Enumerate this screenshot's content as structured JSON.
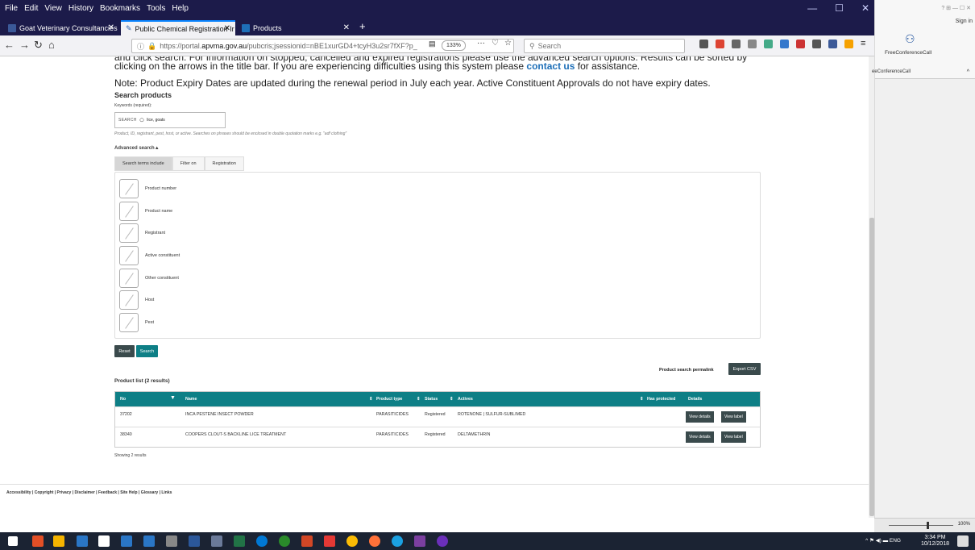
{
  "browser": {
    "menu": [
      "File",
      "Edit",
      "View",
      "History",
      "Bookmarks",
      "Tools",
      "Help"
    ],
    "tabs": [
      {
        "label": "Goat Veterinary Consultancies",
        "color": "#3b5998"
      },
      {
        "label": "Public Chemical Registration Ir",
        "color": "#2b5fa8"
      },
      {
        "label": "Products",
        "color": "#1e6fb8"
      }
    ],
    "url_prefix": "https://portal.",
    "url_domain": "apvma.gov.au",
    "url_rest": "/pubcris;jsessionid=nBE1xurGD4+tcyH3u2sr7fXF?p_",
    "zoom": "133%",
    "search_placeholder": "Search"
  },
  "page": {
    "intro_line1": "and click search. For information on stopped, cancelled and expired registrations please use the advanced search options. Results can be sorted by",
    "intro_line2_a": "clicking on the arrows in the title bar. If you are experiencing difficulties using this system please",
    "intro_link": "contact us",
    "intro_line2_b": "for assistance.",
    "note": "Note: Product Expiry Dates are updated during the renewal period in July each year. Active Constituent Approvals do not have expiry dates.",
    "search_heading": "Search products",
    "keywords_label": "Keywords (required):",
    "search_label": "SEARCH",
    "search_value": "lice, goats",
    "search_help": "Product, ID, registrant, pest, host, or active. Searches on phrases should be enclosed in double quotation marks e.g. \"adf clothing\"",
    "advanced_label": "Advanced search",
    "adv_tabs": [
      "Search terms include",
      "Filter on",
      "Registration"
    ],
    "terms": [
      "Product number",
      "Product name",
      "Registrant",
      "Active constituent",
      "Other constituent",
      "Host",
      "Pest"
    ],
    "reset": "Reset",
    "search_btn": "Search",
    "permalink": "Product search permalink",
    "export": "Export CSV",
    "list_title": "Product list (2 results)",
    "columns": [
      "No",
      "Name",
      "Product type",
      "Status",
      "Actives",
      "Has protected",
      "Details"
    ],
    "rows": [
      {
        "no": "37202",
        "name": "INCA PESTENE INSECT POWDER",
        "type": "PARASITICIDES",
        "status": "Registered",
        "actives": "ROTENONE | SULFUR-SUBLIMED"
      },
      {
        "no": "38340",
        "name": "COOPERS CLOUT-S BACKLINE LICE TREATMENT",
        "type": "PARASITICIDES",
        "status": "Registered",
        "actives": "DELTAMETHRIN"
      }
    ],
    "view_details": "View details",
    "view_label": "View label",
    "showing": "Showing 2 results",
    "footer": "Accessibility | Copyright | Privacy | Disclaimer | Feedback | Site Help | Glossary | Links"
  },
  "side": {
    "title": "FreeConferenceCall",
    "sub": "eeConferenceCall",
    "sign_in": "Sign in",
    "zoom": "100%"
  },
  "taskbar": {
    "time": "3:34 PM",
    "date": "10/12/2018",
    "lang": "ENG"
  }
}
